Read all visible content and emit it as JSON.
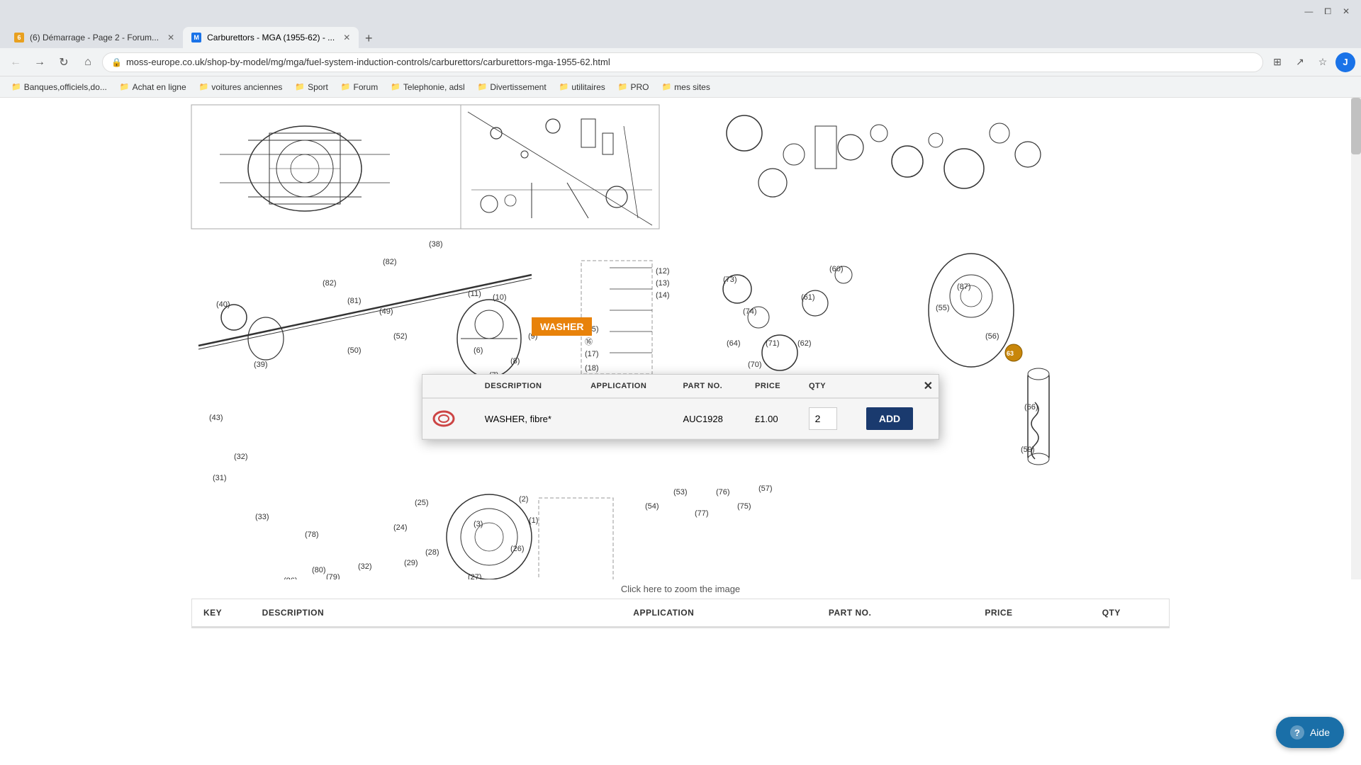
{
  "browser": {
    "tabs": [
      {
        "id": "tab1",
        "favicon_type": "orange",
        "favicon_text": "6",
        "title": "(6) Démarrage - Page 2 - Forum...",
        "active": false
      },
      {
        "id": "tab2",
        "favicon_type": "blue",
        "favicon_text": "M",
        "title": "Carburettors - MGA (1955-62) - ...",
        "active": true
      }
    ],
    "url": "moss-europe.co.uk/shop-by-model/mg/mga/fuel-system-induction-controls/carburettors/carburettors-mga-1955-62.html",
    "bookmarks": [
      {
        "label": "Banques,officiels,do..."
      },
      {
        "label": "Achat en ligne"
      },
      {
        "label": "voitures anciennes"
      },
      {
        "label": "Sport"
      },
      {
        "label": "Forum"
      },
      {
        "label": "Telephonie, adsl"
      },
      {
        "label": "Divertissement"
      },
      {
        "label": "utilitaires"
      },
      {
        "label": "PRO"
      },
      {
        "label": "mes sites"
      }
    ]
  },
  "page": {
    "washer_label": "WASHER",
    "zoom_text": "Click here to zoom the image",
    "modal": {
      "close_label": "✕",
      "columns": [
        "DESCRIPTION",
        "APPLICATION",
        "PART NO.",
        "PRICE",
        "QTY"
      ],
      "row": {
        "description": "WASHER, fibre*",
        "application": "",
        "part_no": "AUC1928",
        "price": "£1.00",
        "qty": "2",
        "add_label": "ADD"
      }
    },
    "bottom_table": {
      "columns": [
        "KEY",
        "DESCRIPTION",
        "APPLICATION",
        "PART NO.",
        "PRICE",
        "QTY"
      ]
    },
    "help_button": "Aide"
  }
}
